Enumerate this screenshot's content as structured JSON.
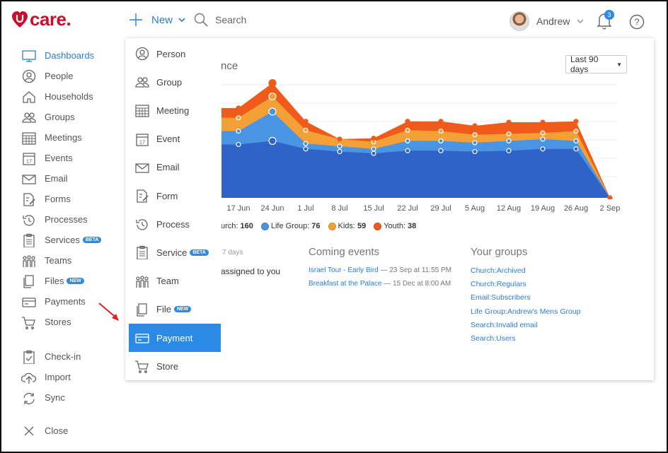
{
  "brand": {
    "logo_text": "care."
  },
  "topbar": {
    "new_label": "New",
    "search_label": "Search",
    "user_name": "Andrew",
    "notification_count": "3"
  },
  "sidebar": {
    "items": [
      {
        "label": "Dashboards",
        "icon": "monitor-icon"
      },
      {
        "label": "People",
        "icon": "person-icon"
      },
      {
        "label": "Households",
        "icon": "house-icon"
      },
      {
        "label": "Groups",
        "icon": "group-icon"
      },
      {
        "label": "Meetings",
        "icon": "calendar-grid-icon"
      },
      {
        "label": "Events",
        "icon": "calendar-icon"
      },
      {
        "label": "Email",
        "icon": "envelope-icon"
      },
      {
        "label": "Forms",
        "icon": "form-icon"
      },
      {
        "label": "Processes",
        "icon": "clock-icon"
      },
      {
        "label": "Services",
        "icon": "clipboard-icon",
        "tag": "BETA"
      },
      {
        "label": "Teams",
        "icon": "team-icon"
      },
      {
        "label": "Files",
        "icon": "files-icon",
        "tag": "NEW"
      },
      {
        "label": "Payments",
        "icon": "card-icon"
      },
      {
        "label": "Stores",
        "icon": "cart-icon"
      }
    ],
    "bottom_items": [
      {
        "label": "Check-in",
        "icon": "checkin-icon"
      },
      {
        "label": "Import",
        "icon": "upload-icon"
      },
      {
        "label": "Sync",
        "icon": "sync-icon"
      }
    ],
    "close_label": "Close"
  },
  "new_menu": {
    "items": [
      {
        "label": "Person",
        "icon": "person-icon"
      },
      {
        "label": "Group",
        "icon": "group-icon"
      },
      {
        "label": "Meeting",
        "icon": "calendar-grid-icon"
      },
      {
        "label": "Event",
        "icon": "calendar-icon"
      },
      {
        "label": "Email",
        "icon": "envelope-icon"
      },
      {
        "label": "Form",
        "icon": "form-icon"
      },
      {
        "label": "Process",
        "icon": "clock-icon"
      },
      {
        "label": "Service",
        "icon": "clipboard-icon",
        "tag": "BETA"
      },
      {
        "label": "Team",
        "icon": "team-icon"
      },
      {
        "label": "File",
        "icon": "files-icon",
        "tag": "NEW"
      },
      {
        "label": "Payment",
        "icon": "card-icon",
        "highlighted": true
      },
      {
        "label": "Store",
        "icon": "cart-icon"
      }
    ]
  },
  "dashboard": {
    "chart_title_partial": "nce",
    "range_select": "Last 90 days",
    "todo_partial_meta": "7 days",
    "todo_partial_text": "assigned to you",
    "coming_events": {
      "heading": "Coming events",
      "items": [
        {
          "title": "Israel Tour - Early Bird",
          "when": "23 Sep at 11:55 PM"
        },
        {
          "title": "Breakfast at the Palace",
          "when": "15 Dec at 8:00 AM"
        }
      ]
    },
    "your_groups": {
      "heading": "Your groups",
      "items": [
        "Church:Archived",
        "Church:Regulars",
        "Email:Subscribers",
        "Life Group:Andrew's Mens Group",
        "Search:Invalid email",
        "Search:Users"
      ]
    }
  },
  "chart_data": {
    "type": "area",
    "stacked": true,
    "categories": [
      "17 Jun",
      "24 Jun",
      "1 Jul",
      "8 Jul",
      "15 Jul",
      "22 Jul",
      "29 Jul",
      "5 Aug",
      "12 Aug",
      "19 Aug",
      "26 Aug",
      "2 Sep"
    ],
    "series": [
      {
        "name": "Church",
        "legend_label": "urch",
        "total": 160,
        "color": "#2f63c8",
        "values": [
          60,
          64,
          55,
          52,
          50,
          53,
          53,
          52,
          53,
          55,
          55,
          0
        ]
      },
      {
        "name": "Life Group",
        "legend_label": "Life Group",
        "total": 76,
        "color": "#4a94e4",
        "values": [
          15,
          33,
          6,
          6,
          5,
          11,
          11,
          10,
          11,
          11,
          9,
          0
        ]
      },
      {
        "name": "Kids",
        "legend_label": "Kids",
        "total": 59,
        "color": "#f3a137",
        "values": [
          15,
          17,
          15,
          8,
          8,
          12,
          11,
          9,
          8,
          7,
          11,
          0
        ]
      },
      {
        "name": "Youth",
        "legend_label": "Youth",
        "total": 38,
        "color": "#f05a1a",
        "values": [
          11,
          15,
          10,
          0,
          4,
          10,
          11,
          10,
          13,
          12,
          11,
          0
        ]
      }
    ],
    "ylim": [
      0,
      135
    ],
    "grid": true,
    "legend_position": "bottom-left"
  },
  "colors": {
    "accent": "#2b8ae6",
    "brand": "#c8102e",
    "pointer_arrow": "#e02020"
  }
}
